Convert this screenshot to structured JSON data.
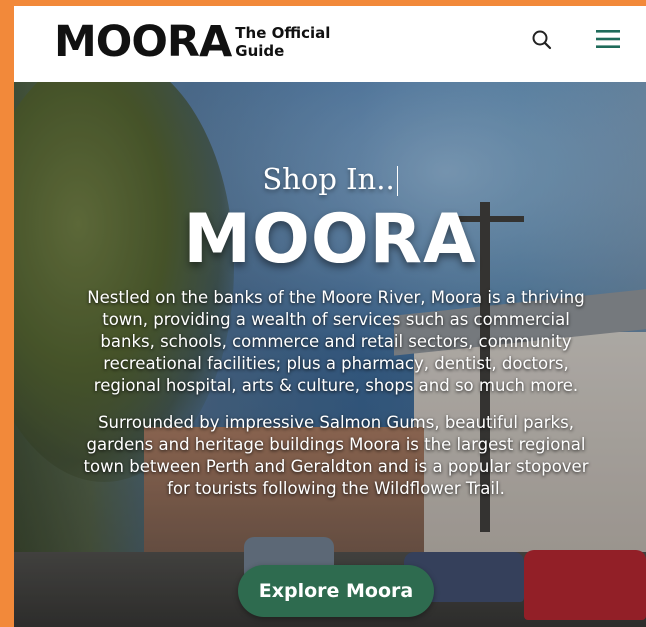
{
  "header": {
    "logo_word": "MOORA",
    "logo_tag_line1": "The Official",
    "logo_tag_line2": "Guide",
    "search_icon": "search-icon",
    "menu_icon": "hamburger-menu-icon"
  },
  "hero": {
    "subtitle": "Shop In..",
    "title": "MOORA",
    "paragraph1": "Nestled on the banks of the Moore River, Moora is a thriving town, providing a wealth of services such as commercial banks, schools, commerce and retail sectors, community recreational facilities; plus a pharmacy, dentist, doctors, regional hospital, arts & culture, shops and so much more.",
    "paragraph2": "Surrounded by impressive Salmon Gums, beautiful parks, gardens and heritage buildings Moora is the largest regional town between Perth and Geraldton and is a popular stopover for tourists following the Wildflower Trail.",
    "cta_label": "Explore Moora"
  },
  "colors": {
    "frame": "#f2893a",
    "cta": "#2e6b4f",
    "text_dark": "#111111"
  }
}
